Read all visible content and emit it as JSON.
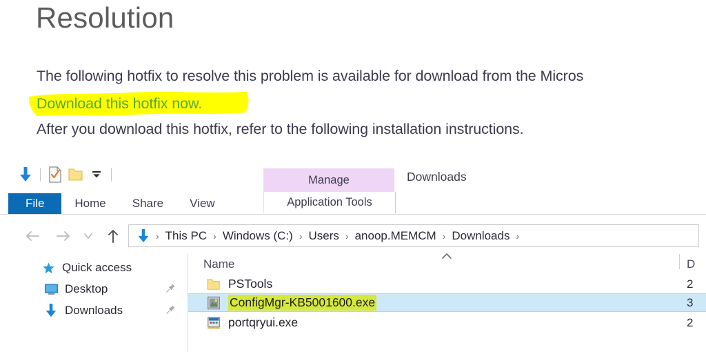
{
  "article": {
    "title": "Resolution",
    "paragraph_1": "The following hotfix to resolve this problem is available for download from the Micros",
    "hotfix_link": "Download this hotfix now.",
    "paragraph_3": "After you download this hotfix, refer to the following installation instructions.",
    "highlight_color": "#ffff00",
    "link_color": "#55a630",
    "title_color": "#5c5c5c"
  },
  "explorer": {
    "window_title": "Downloads",
    "quick_access_toolbar": [
      {
        "name": "downloads-icon",
        "glyph": "download-arrow"
      },
      {
        "name": "properties-icon",
        "glyph": "document-check"
      },
      {
        "name": "new-folder-icon",
        "glyph": "folder"
      },
      {
        "name": "customize-qat-icon",
        "glyph": "chevron-down"
      }
    ],
    "ribbon": {
      "tabs": [
        {
          "label": "File",
          "active": true
        },
        {
          "label": "Home",
          "active": false
        },
        {
          "label": "Share",
          "active": false
        },
        {
          "label": "View",
          "active": false
        }
      ],
      "contextual_group": {
        "title": "Manage",
        "tab_label": "Application Tools",
        "title_bg": "#efd6f7"
      },
      "file_tab_color": "#0c6bb5"
    },
    "address_bar": {
      "nav_buttons": [
        {
          "name": "back-button",
          "glyph": "←"
        },
        {
          "name": "forward-button",
          "glyph": "→"
        },
        {
          "name": "recent-locations-button",
          "glyph": "⌄"
        },
        {
          "name": "up-button",
          "glyph": "↑"
        }
      ],
      "location_icon": "download-arrow",
      "breadcrumbs": [
        "This PC",
        "Windows (C:)",
        "Users",
        "anoop.MEMCM",
        "Downloads"
      ],
      "separator": "›"
    },
    "columns": {
      "name": "Name",
      "date": "D",
      "sort_indicator": "˄",
      "sorted_by": "Name",
      "sort_direction": "ascending"
    },
    "nav_pane": [
      {
        "label": "Quick access",
        "icon": "star-icon",
        "pinned": false
      },
      {
        "label": "Desktop",
        "icon": "monitor-icon",
        "pinned": true
      },
      {
        "label": "Downloads",
        "icon": "download-arrow-icon",
        "pinned": true
      }
    ],
    "files": [
      {
        "name": "PSTools",
        "icon": "folder-icon",
        "date": "2",
        "selected": false,
        "highlighted": false
      },
      {
        "name": "ConfigMgr-KB5001600.exe",
        "icon": "installer-exe-icon",
        "date": "3",
        "selected": true,
        "highlighted": true
      },
      {
        "name": "portqryui.exe",
        "icon": "application-exe-icon",
        "date": "2",
        "selected": false,
        "highlighted": false
      }
    ],
    "selection_color": "#cde8f7",
    "file_highlight_color": "#d6e83c"
  }
}
